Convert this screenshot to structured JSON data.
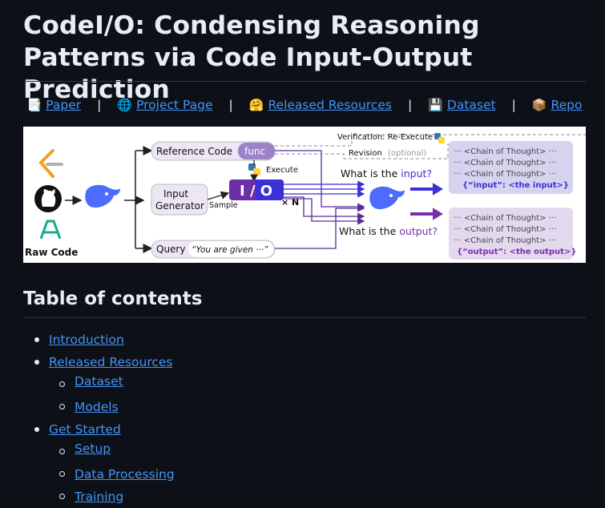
{
  "page": {
    "title": "CodeI/O: Condensing Reasoning Patterns via Code Input-Output Prediction",
    "toc_heading": "Table of contents"
  },
  "links": [
    {
      "icon": "📑",
      "icon_name": "bookmark-tabs-icon",
      "label": "Paper"
    },
    {
      "icon": "🌐",
      "icon_name": "globe-icon",
      "label": "Project Page"
    },
    {
      "icon": "🤗",
      "icon_name": "hugging-face-icon",
      "label": "Released Resources"
    },
    {
      "icon": "💾",
      "icon_name": "floppy-disk-icon",
      "label": "Dataset"
    },
    {
      "icon": "📦",
      "icon_name": "package-icon",
      "label": "Repo"
    }
  ],
  "separator": "|",
  "figure": {
    "raw_code": "Raw Code",
    "reference_code": "Reference Code",
    "func": "func",
    "execute": "Execute",
    "input_generator_line1": "Input",
    "input_generator_line2": "Generator",
    "sample": "Sample",
    "io": "I / O",
    "times_n": "× N",
    "query": "Query",
    "query_quote": "“You are given ···”",
    "verification": "Verification: Re-Execute",
    "revision": "Revision",
    "optional": "(optional)",
    "what_input_prefix": "What is the ",
    "what_input_word": "input?",
    "what_output_prefix": "What is the ",
    "what_output_word": "output?",
    "cot_line": "··· <Chain of Thought> ···",
    "input_result": "{“input”: <the input>}",
    "output_result": "{“output”: <the output>}"
  },
  "toc": [
    {
      "level": 1,
      "label": "Introduction"
    },
    {
      "level": 1,
      "label": "Released Resources"
    },
    {
      "level": 2,
      "label": "Dataset"
    },
    {
      "level": 2,
      "label": "Models"
    },
    {
      "level": 1,
      "label": "Get Started"
    },
    {
      "level": 2,
      "label": "Setup"
    },
    {
      "level": 2,
      "label": "Data Processing"
    },
    {
      "level": 2,
      "label": "Training"
    }
  ],
  "colors": {
    "background": "#0d1117",
    "text": "#e6edf3",
    "link": "#4493f8",
    "divider": "#30363d",
    "io_purple": "#6b2fa8",
    "input_arrow": "#3b2fd6",
    "output_arrow": "#7b2fa8"
  }
}
